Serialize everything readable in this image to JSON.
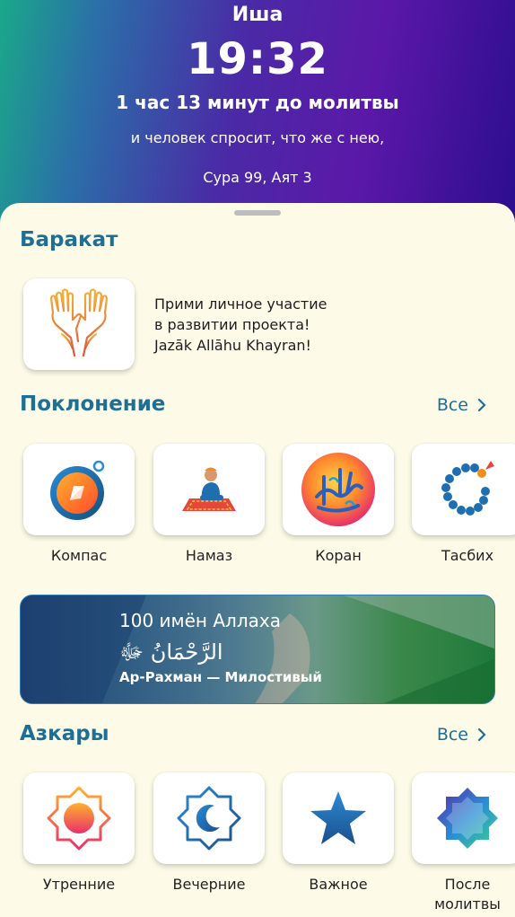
{
  "header": {
    "prayer_name": "Иша",
    "time": "19:32",
    "countdown": "1 час 13 минут до молитвы",
    "verse": "и человек спросит, что же с нею,",
    "verse_ref": "Сура 99, Аят 3"
  },
  "baraka": {
    "title": "Баракат",
    "line1": "Прими личное участие",
    "line2": "в развитии проекта!",
    "line3": "Jazāk Allāhu Khayran!"
  },
  "worship": {
    "title": "Поклонение",
    "see_all": "Все",
    "items": [
      {
        "label": "Компас"
      },
      {
        "label": "Намаз"
      },
      {
        "label": "Коран"
      },
      {
        "label": "Тасбих"
      }
    ]
  },
  "names_banner": {
    "title": "100 имён Аллаха",
    "arabic": "الرَّحْمَانُ ﷻ",
    "name": "Ар-Рахман — Милостивый"
  },
  "azkar": {
    "title": "Азкары",
    "see_all": "Все",
    "items": [
      {
        "label": "Утренние"
      },
      {
        "label": "Вечерние"
      },
      {
        "label": "Важное"
      },
      {
        "label": "После молитвы"
      }
    ]
  },
  "colors": {
    "accent": "#1e6f95",
    "background": "#fdfbe8"
  }
}
